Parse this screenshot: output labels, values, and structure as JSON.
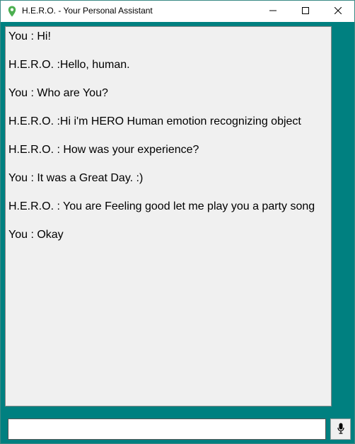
{
  "window": {
    "title": "H.E.R.O. - Your Personal Assistant",
    "minimize_icon": "minimize-icon",
    "maximize_icon": "maximize-icon",
    "close_icon": "close-icon",
    "app_icon": "location-pin-icon",
    "accent_color": "#008080"
  },
  "chat": {
    "messages": [
      "You : Hi!",
      "H.E.R.O. :Hello, human.",
      "You : Who are You?",
      "H.E.R.O. :Hi i'm HERO Human emotion recognizing object",
      "H.E.R.O. : How was your experience?",
      "You : It was a Great Day. :)",
      "H.E.R.O. : You are Feeling good let me play you a party song",
      "You : Okay"
    ]
  },
  "input": {
    "value": "",
    "mic_icon": "microphone-icon"
  }
}
